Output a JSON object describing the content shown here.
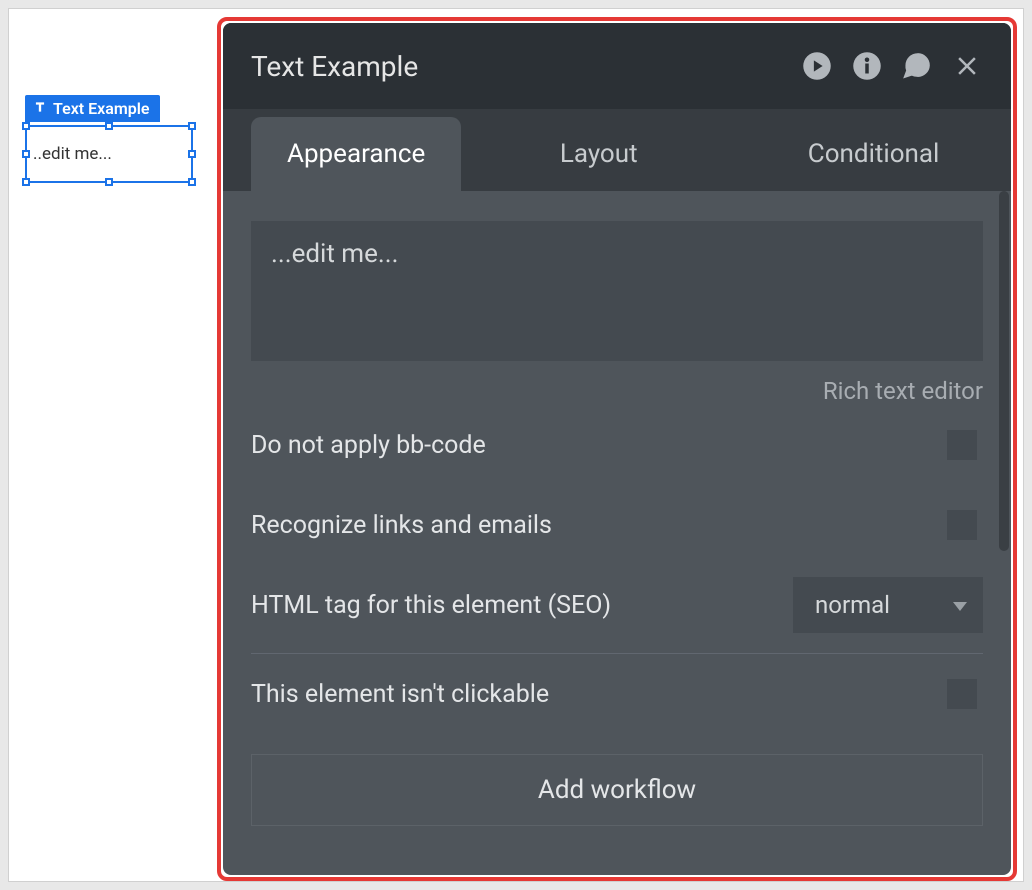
{
  "canvas": {
    "element_type_label": "Text Example",
    "content": "..edit me..."
  },
  "panel": {
    "title": "Text Example",
    "tabs": {
      "appearance": "Appearance",
      "layout": "Layout",
      "conditional": "Conditional"
    },
    "text_value": "...edit me...",
    "rich_text_link": "Rich text editor",
    "rows": {
      "bbcode": "Do not apply bb-code",
      "links": "Recognize links and emails",
      "seo_label": "HTML tag for this element (SEO)",
      "seo_value": "normal",
      "clickable": "This element isn't clickable"
    },
    "workflow_button": "Add workflow"
  }
}
